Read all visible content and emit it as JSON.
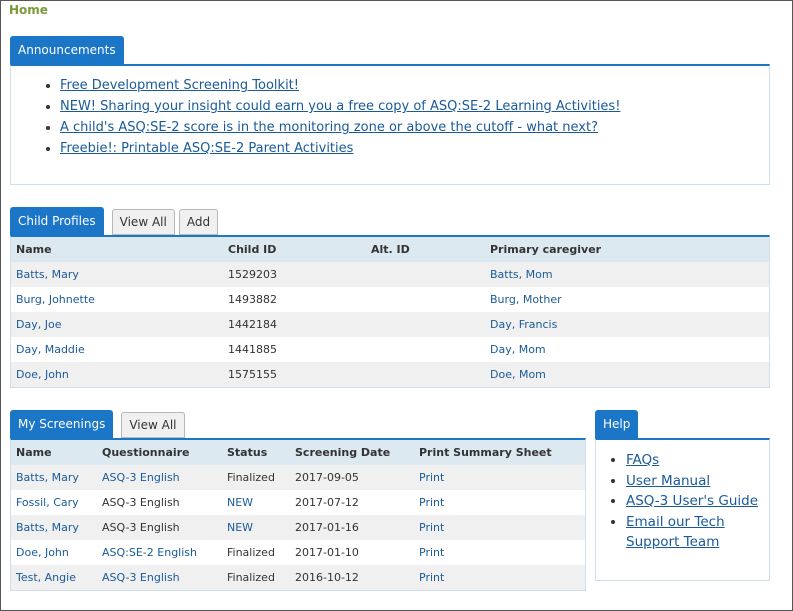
{
  "breadcrumb": {
    "home": "Home"
  },
  "announcements": {
    "tab": "Announcements",
    "items": [
      "Free Development Screening Toolkit!",
      "NEW! Sharing your insight could earn you a free copy of ASQ:SE-2 Learning Activities!",
      "A child's ASQ:SE-2 score is in the monitoring zone or above the cutoff - what next?",
      "Freebie!: Printable ASQ:SE-2 Parent Activities"
    ]
  },
  "child_profiles": {
    "tab": "Child Profiles",
    "view_all": "View All",
    "add": "Add",
    "columns": [
      "Name",
      "Child ID",
      "Alt. ID",
      "Primary caregiver"
    ],
    "rows": [
      {
        "name": "Batts, Mary",
        "child_id": "1529203",
        "alt_id": "",
        "caregiver": "Batts, Mom"
      },
      {
        "name": "Burg, Johnette",
        "child_id": "1493882",
        "alt_id": "",
        "caregiver": "Burg, Mother"
      },
      {
        "name": "Day, Joe",
        "child_id": "1442184",
        "alt_id": "",
        "caregiver": "Day, Francis"
      },
      {
        "name": "Day, Maddie",
        "child_id": "1441885",
        "alt_id": "",
        "caregiver": "Day, Mom"
      },
      {
        "name": "Doe, John",
        "child_id": "1575155",
        "alt_id": "",
        "caregiver": "Doe, Mom"
      }
    ]
  },
  "my_screenings": {
    "tab": "My Screenings",
    "view_all": "View All",
    "columns": [
      "Name",
      "Questionnaire",
      "Status",
      "Screening Date",
      "Print Summary Sheet"
    ],
    "rows": [
      {
        "name": "Batts, Mary",
        "questionnaire": "ASQ-3 English",
        "q_link": true,
        "status": "Finalized",
        "date": "2017-09-05",
        "print": "Print"
      },
      {
        "name": "Fossil, Cary",
        "questionnaire": "ASQ-3 English",
        "q_link": false,
        "status": "NEW",
        "date": "2017-07-12",
        "print": "Print"
      },
      {
        "name": "Batts, Mary",
        "questionnaire": "ASQ-3 English",
        "q_link": false,
        "status": "NEW",
        "date": "2017-01-16",
        "print": "Print"
      },
      {
        "name": "Doe, John",
        "questionnaire": "ASQ:SE-2 English",
        "q_link": true,
        "status": "Finalized",
        "date": "2017-01-10",
        "print": "Print"
      },
      {
        "name": "Test, Angie",
        "questionnaire": "ASQ-3 English",
        "q_link": true,
        "status": "Finalized",
        "date": "2016-10-12",
        "print": "Print"
      }
    ]
  },
  "help": {
    "tab": "Help",
    "items": [
      "FAQs",
      "User Manual",
      "ASQ-3 User's Guide",
      "Email our Tech Support Team"
    ]
  },
  "colors": {
    "accent": "#1b76c7",
    "link": "#1a5a9a",
    "home": "#7a9a3a",
    "header_bg": "#dde9f1"
  }
}
